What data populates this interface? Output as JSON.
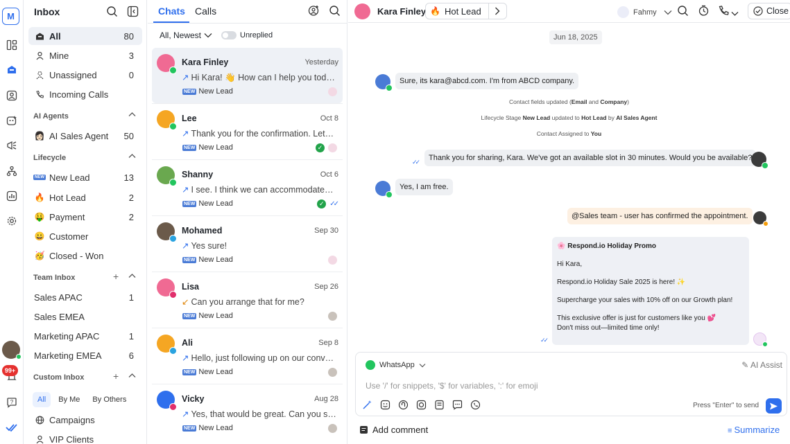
{
  "rail": {
    "logo": "M",
    "notifications_badge": "99+"
  },
  "sidebar": {
    "title": "Inbox",
    "items": [
      {
        "label": "All",
        "count": "80"
      },
      {
        "label": "Mine",
        "count": "3"
      },
      {
        "label": "Unassigned",
        "count": "0"
      },
      {
        "label": "Incoming Calls",
        "count": ""
      }
    ],
    "ai_agents": {
      "title": "AI Agents",
      "items": [
        {
          "label": "AI Sales Agent",
          "count": "50"
        }
      ]
    },
    "lifecycle": {
      "title": "Lifecycle",
      "items": [
        {
          "label": "New Lead",
          "count": "13"
        },
        {
          "label": "Hot Lead",
          "count": "2"
        },
        {
          "label": "Payment",
          "count": "2"
        },
        {
          "label": "Customer",
          "count": ""
        },
        {
          "label": "Closed - Won",
          "count": ""
        }
      ]
    },
    "team_inbox": {
      "title": "Team Inbox",
      "items": [
        {
          "label": "Sales APAC",
          "count": "1"
        },
        {
          "label": "Sales EMEA",
          "count": ""
        },
        {
          "label": "Marketing APAC",
          "count": "1"
        },
        {
          "label": "Marketing EMEA",
          "count": "6"
        }
      ]
    },
    "custom_inbox": {
      "title": "Custom Inbox",
      "pills": [
        "All",
        "By Me",
        "By Others"
      ],
      "items": [
        {
          "label": "Campaigns"
        },
        {
          "label": "VIP Clients"
        }
      ]
    }
  },
  "list": {
    "tabs": [
      "Chats",
      "Calls"
    ],
    "filter": "All, Newest",
    "unreplied_label": "Unreplied",
    "conversations": [
      {
        "name": "Kara Finley",
        "date": "Yesterday",
        "preview": "Hi Kara! 👋 How can I help you today?",
        "direction": "↗",
        "tag": "New Lead",
        "color": "#f06a93",
        "channel_color": "#22c55e"
      },
      {
        "name": "Lee",
        "date": "Oct 8",
        "preview": "Thank you for the confirmation. Let…",
        "direction": "↗",
        "tag": "New Lead",
        "color": "#f5a623",
        "channel_color": "#22c55e"
      },
      {
        "name": "Shanny",
        "date": "Oct 6",
        "preview": "I see. I think we can accommodate…",
        "direction": "↗",
        "tag": "New Lead",
        "color": "#6aa84f",
        "channel_color": "#22c55e"
      },
      {
        "name": "Mohamed",
        "date": "Sep 30",
        "preview": "Yes sure!",
        "direction": "↗",
        "tag": "New Lead",
        "color": "#6b5a4a",
        "channel_color": "#2aa3e0"
      },
      {
        "name": "Lisa",
        "date": "Sep 26",
        "preview": "Can you arrange that for me?",
        "direction": "↙",
        "tag": "New Lead",
        "color": "#f06a93",
        "channel_color": "#e1306c"
      },
      {
        "name": "Ali",
        "date": "Sep 8",
        "preview": "Hello, just following up on our convo…",
        "direction": "↗",
        "tag": "New Lead",
        "color": "#f5a623",
        "channel_color": "#2aa3e0"
      },
      {
        "name": "Vicky",
        "date": "Aug 28",
        "preview": "Yes, that would be great. Can you sh…",
        "direction": "↗",
        "tag": "New Lead",
        "color": "#2f6fed",
        "channel_color": "#e1306c"
      }
    ]
  },
  "chat": {
    "contact_name": "Kara Finley",
    "lifecycle_chip": "Hot Lead",
    "assignee": "Fahmy",
    "close_label": "Close",
    "date": "Jun 18, 2025",
    "msg1": "Sure, its kara@abcd.com. I'm from ABCD company.",
    "sys1_pre": "Contact fields updated (",
    "sys1_b1": "Email",
    "sys1_and": " and ",
    "sys1_b2": "Company",
    "sys1_post": ")",
    "sys2_pre": "Lifecycle Stage ",
    "sys2_b1": "New Lead",
    "sys2_mid": " updated to ",
    "sys2_b2": "Hot Lead",
    "sys2_by": " by ",
    "sys2_b3": "AI Sales Agent",
    "sys3_pre": "Contact Assigned to ",
    "sys3_b": "You",
    "msg2": "Thank you for sharing, Kara. We've got an available slot in 30 minutes. Would you be available?",
    "msg3": "Yes, I am free.",
    "msg4": "@Sales team - user has confirmed the appointment.",
    "promo": {
      "title": "🌸 Respond.io Holiday Promo",
      "l1": "Hi Kara,",
      "l2": "Respond.io Holiday Sale 2025 is here! ✨",
      "l3": "Supercharge your sales with 10% off on our Growth plan!",
      "l4": "This exclusive offer is just for customers like you 💕",
      "l5": "Don't miss out—limited time only!"
    },
    "composer": {
      "channel": "WhatsApp",
      "ai_assist": "AI Assist",
      "placeholder": "Use '/' for snippets, '$' for variables, ':' for emoji",
      "hint": "Press \"Enter\" to send"
    },
    "add_comment": "Add comment",
    "summarize": "Summarize"
  },
  "colors": {
    "accent": "#2f6fed",
    "whatsapp": "#22c55e",
    "selected_bg": "#eef1f6"
  }
}
